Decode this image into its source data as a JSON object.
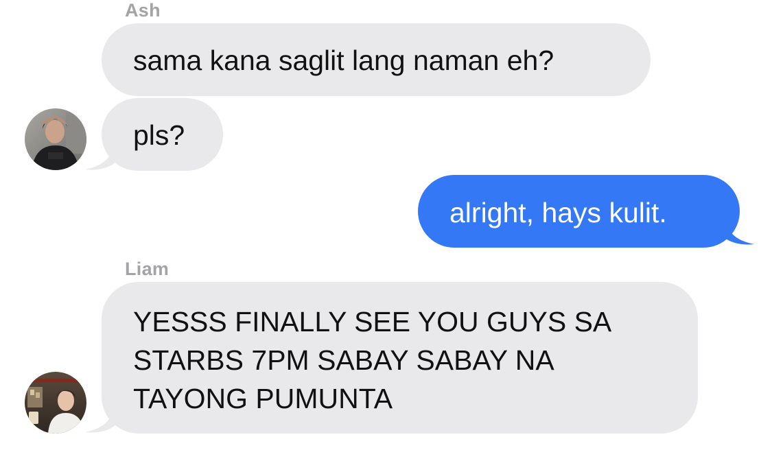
{
  "conversation": {
    "messages": [
      {
        "sender": "Ash",
        "direction": "incoming",
        "text": "sama kana saglit lang naman eh?"
      },
      {
        "sender": "Ash",
        "direction": "incoming",
        "text": "pls?"
      },
      {
        "sender": "me",
        "direction": "outgoing",
        "text": "alright, hays kulit."
      },
      {
        "sender": "Liam",
        "direction": "incoming",
        "lines": [
          "YESSS FINALLY SEE YOU GUYS SA",
          "STARBS 7PM SABAY SABAY NA",
          "TAYONG PUMUNTA"
        ]
      }
    ],
    "sender_labels": {
      "ash": "Ash",
      "liam": "Liam"
    }
  },
  "colors": {
    "incoming_bubble": "#e9e9eb",
    "outgoing_bubble": "#3478f6",
    "sender_label": "#a3a3a8"
  },
  "icons": {
    "ash_avatar": "ash-avatar-photo",
    "liam_avatar": "liam-avatar-photo"
  }
}
